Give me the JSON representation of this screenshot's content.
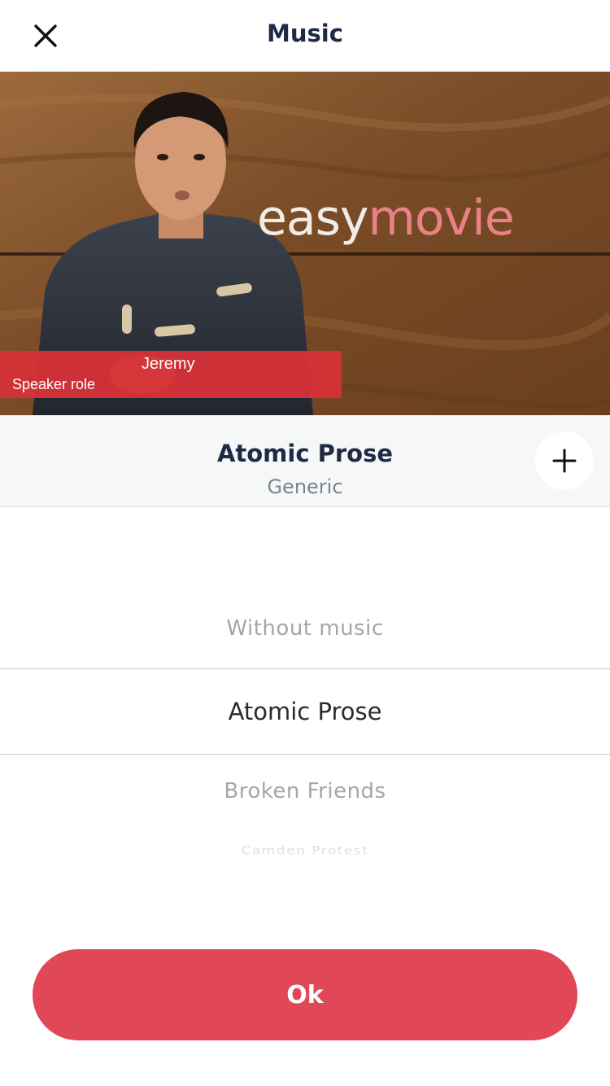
{
  "header": {
    "title": "Music",
    "close_icon": "close-icon"
  },
  "video": {
    "logo_part_1": "easy",
    "logo_part_2": "movie",
    "speaker_name": "Jeremy",
    "speaker_role": "Speaker role",
    "lower_third_color": "#d63238"
  },
  "track": {
    "title": "Atomic Prose",
    "genre": "Generic",
    "add_icon": "plus-icon"
  },
  "picker": {
    "items": [
      "Without music",
      "Atomic Prose",
      "Broken Friends",
      "Camden Protest"
    ],
    "selected": "Atomic Prose"
  },
  "footer": {
    "ok_label": "Ok",
    "accent_color": "#e04858"
  }
}
